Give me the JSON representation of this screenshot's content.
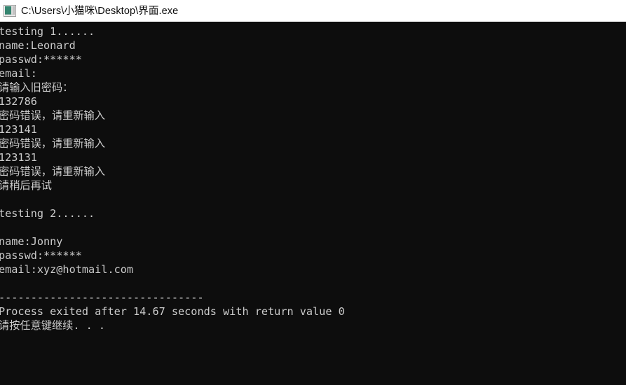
{
  "window": {
    "title": "C:\\Users\\小猫咪\\Desktop\\界面.exe",
    "icon": "console-app-icon",
    "titlebar_bg": "#ffffff",
    "titlebar_text_color": "#0c0c0c",
    "console_bg": "#0d0d0d",
    "console_text_color": "#cccccc"
  },
  "console": {
    "lines": [
      "testing 1......",
      "name:Leonard",
      "passwd:******",
      "email:",
      "请输入旧密码：",
      "132786",
      "密码错误，请重新输入",
      "123141",
      "密码错误，请重新输入",
      "123131",
      "密码错误，请重新输入",
      "请稍后再试",
      "",
      "testing 2......",
      "",
      "name:Jonny",
      "passwd:******",
      "email:xyz@hotmail.com",
      "",
      "--------------------------------",
      "Process exited after 14.67 seconds with return value 0",
      "请按任意键继续. . ."
    ]
  }
}
